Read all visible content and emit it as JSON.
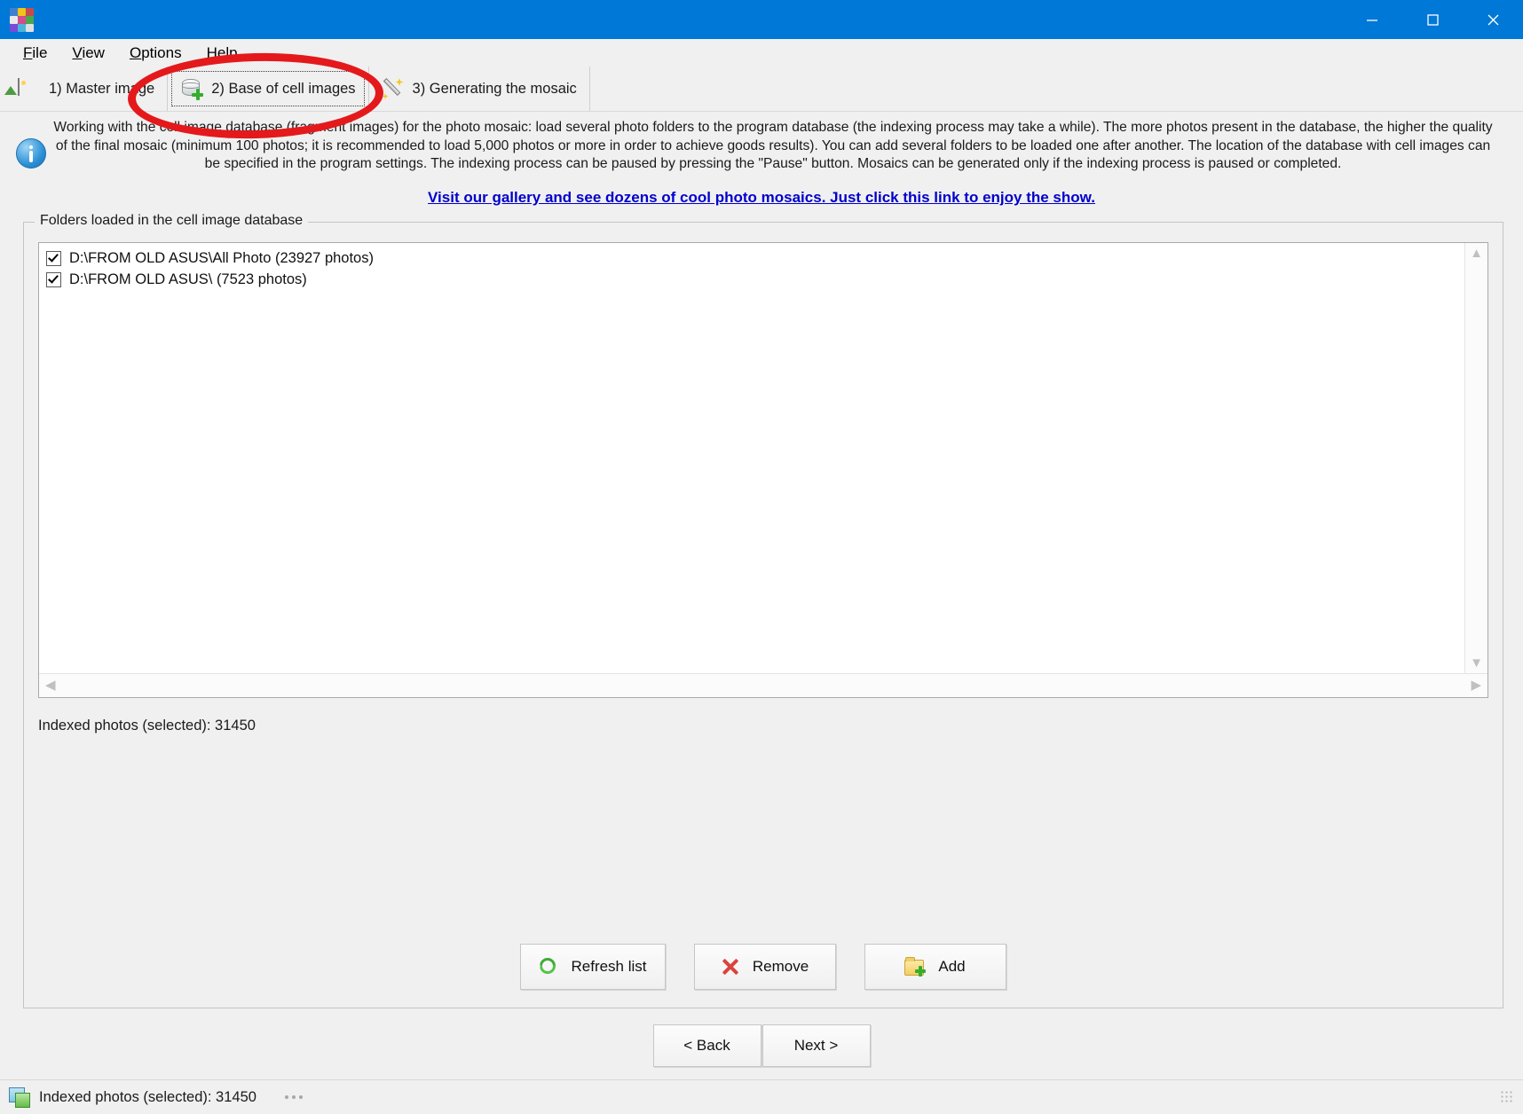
{
  "window": {
    "title": "",
    "controls": {
      "minimize": "minimize",
      "maximize": "maximize",
      "close": "close"
    },
    "accent_color": "#0078d7"
  },
  "menubar": {
    "items": [
      {
        "label": "File",
        "accel": "F"
      },
      {
        "label": "View",
        "accel": "V"
      },
      {
        "label": "Options",
        "accel": "O"
      },
      {
        "label": "Help",
        "accel": "H"
      }
    ]
  },
  "tabs": [
    {
      "label": "1) Master image",
      "icon": "picture-icon",
      "active": false
    },
    {
      "label": "2) Base of cell images",
      "icon": "database-add-icon",
      "active": true
    },
    {
      "label": "3) Generating the mosaic",
      "icon": "magic-wand-icon",
      "active": false
    }
  ],
  "info": {
    "icon": "info-icon",
    "text": "Working with the cell image database (fragment images) for the photo mosaic: load several photo folders to the program database (the indexing process may take a while). The more photos present in the database, the higher the quality of the final mosaic (minimum 100 photos; it is recommended to load 5,000 photos or more in order to achieve goods results). You can add several folders to be loaded one after another. The location of the database with cell images can be specified in the program settings. The indexing process can be paused by pressing the \"Pause\" button. Mosaics can be generated only if the indexing process is paused or completed.",
    "link_text": "Visit our gallery and see dozens of cool photo mosaics. Just click this link to enjoy the show.",
    "link_color": "#0000cd"
  },
  "groupbox": {
    "title": "Folders loaded in the cell image database",
    "folders": [
      {
        "checked": true,
        "path": "D:\\FROM OLD ASUS\\All Photo (23927 photos)"
      },
      {
        "checked": true,
        "path": "D:\\FROM OLD ASUS\\ (7523 photos)"
      }
    ],
    "indexed_label": "Indexed photos (selected): 31450",
    "buttons": [
      {
        "label": "Refresh list",
        "icon": "refresh-icon"
      },
      {
        "label": "Remove",
        "icon": "x-icon"
      },
      {
        "label": "Add",
        "icon": "folder-add-icon"
      }
    ]
  },
  "wizard_nav": {
    "back_label": "< Back",
    "next_label": "Next >"
  },
  "statusbar": {
    "icon": "mosaic-icon",
    "text": "Indexed photos (selected): 31450"
  },
  "annotation": {
    "shape": "ellipse",
    "color": "#e4191c",
    "target": "2) Base of cell images"
  }
}
